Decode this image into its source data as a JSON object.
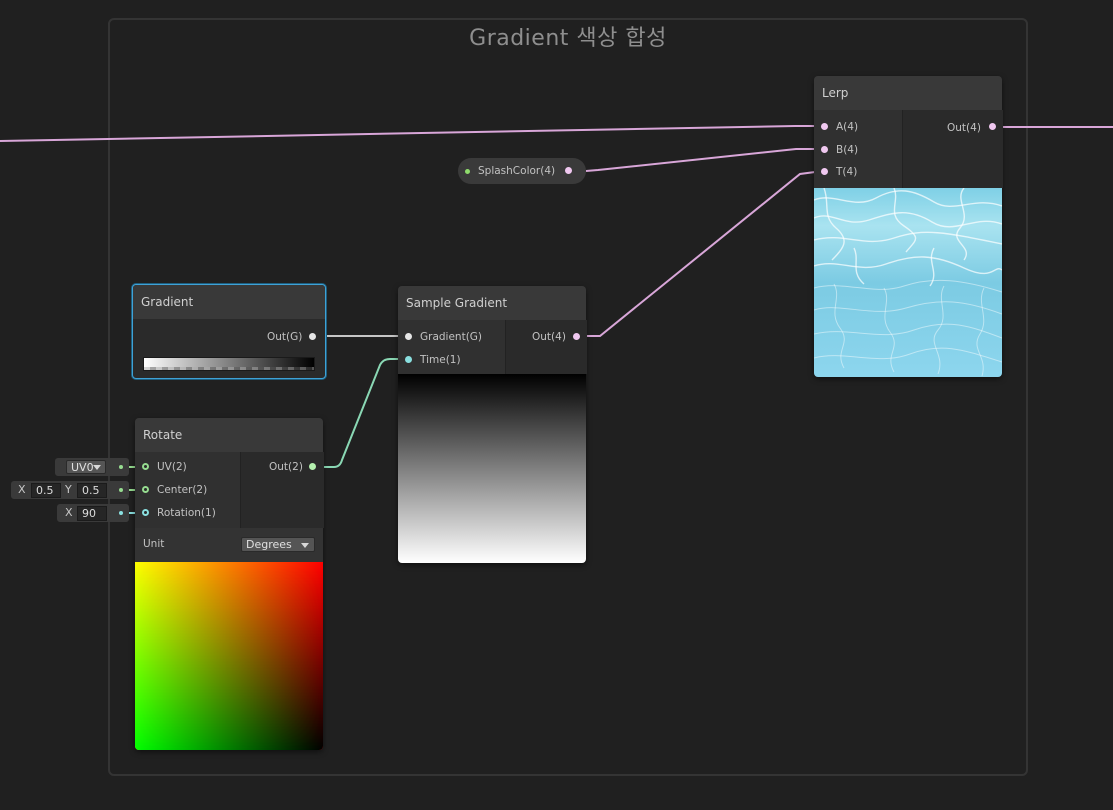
{
  "group": {
    "title": "Gradient 색상 합성"
  },
  "lerp_node": {
    "title": "Lerp",
    "inputs": [
      "A(4)",
      "B(4)",
      "T(4)"
    ],
    "output": "Out(4)",
    "preview": "water-caustics-texture"
  },
  "splash_property": {
    "label": "SplashColor(4)"
  },
  "gradient_node": {
    "title": "Gradient",
    "output": "Out(G)",
    "gradient_preview": "white-to-black"
  },
  "sample_gradient_node": {
    "title": "Sample Gradient",
    "inputs": [
      "Gradient(G)",
      "Time(1)"
    ],
    "output": "Out(4)",
    "preview": "black-to-white-vertical"
  },
  "rotate_node": {
    "title": "Rotate",
    "inputs": [
      "UV(2)",
      "Center(2)",
      "Rotation(1)"
    ],
    "output": "Out(2)",
    "unit_label": "Unit",
    "unit_value": "Degrees",
    "preview": "uv-rotated-red-green"
  },
  "inline_inputs": {
    "uv_channel": "UV0",
    "center_x_label": "X",
    "center_x": "0.5",
    "center_y_label": "Y",
    "center_y": "0.5",
    "rotation_x_label": "X",
    "rotation_x": "90"
  },
  "colors": {
    "background": "#202020",
    "vector4_wire": "#d8a6d8",
    "vector2_wire": "#96dc90",
    "float_wire": "#8ae0e0",
    "gradient_wire": "#c6c6c6",
    "selection": "#3fa2d6"
  }
}
